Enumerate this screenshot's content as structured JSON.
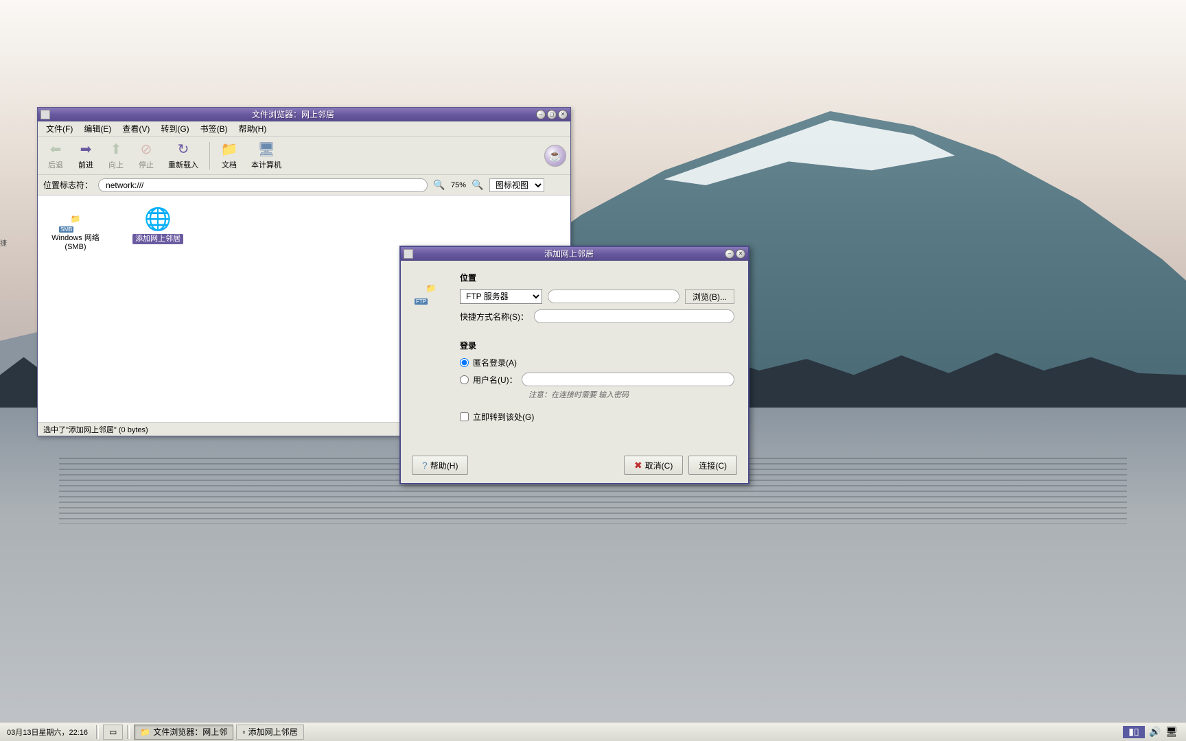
{
  "wallpaper": "mountain-lake",
  "edge_label": "捷",
  "browser_window": {
    "title": "文件浏览器：网上邻居",
    "menubar": [
      "文件(F)",
      "编辑(E)",
      "查看(V)",
      "转到(G)",
      "书签(B)",
      "帮助(H)"
    ],
    "toolbar": {
      "back": "后退",
      "forward": "前进",
      "up": "向上",
      "stop": "停止",
      "reload": "重新载入",
      "documents": "文档",
      "computer": "本计算机"
    },
    "location": {
      "label": "位置标志符：",
      "value": "network:///",
      "zoom": "75%",
      "view_mode": "图标视图"
    },
    "items": [
      {
        "label": "Windows 网络 (SMB)",
        "icon": "smb-folder"
      },
      {
        "label": "添加网上邻居",
        "icon": "network-add",
        "selected": true
      }
    ],
    "statusbar": "选中了\"添加网上邻居\" (0 bytes)"
  },
  "dialog": {
    "title": "添加网上邻居",
    "section_location": "位置",
    "server_type": "FTP 服务器",
    "server_address": "",
    "browse": "浏览(B)...",
    "shortcut_label": "快捷方式名称(S)：",
    "shortcut_value": "",
    "section_login": "登录",
    "anon_login": "匿名登录(A)",
    "username_label": "用户名(U)：",
    "username_value": "",
    "hint": "注意：在连接时需要\n输入密码",
    "goto_now": "立即转到该处(G)",
    "help": "帮助(H)",
    "cancel": "取消(C)",
    "connect": "连接(C)"
  },
  "taskbar": {
    "clock": "03月13日星期六，22:16",
    "tasks": [
      {
        "label": "文件浏览器：网上邻",
        "icon": "folder"
      },
      {
        "label": "添加网上邻居",
        "icon": "window"
      }
    ]
  }
}
